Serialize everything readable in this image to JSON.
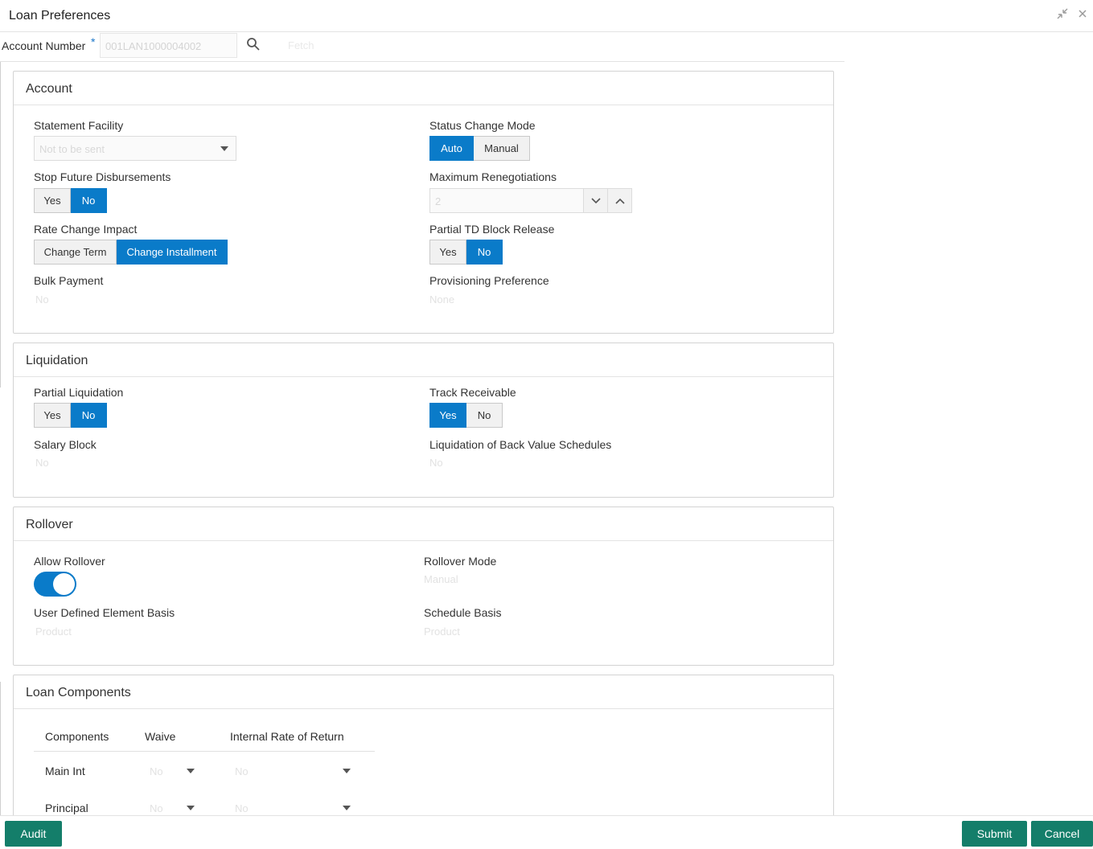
{
  "window": {
    "title": "Loan Preferences"
  },
  "account_bar": {
    "label": "Account Number",
    "required_mark": "*",
    "account_value": "001LAN1000004002",
    "ghost_text": "Fetch"
  },
  "account_section": {
    "title": "Account",
    "statement_facility": {
      "label": "Statement Facility",
      "value": "Not to be sent"
    },
    "status_change_mode": {
      "label": "Status Change Mode",
      "options": [
        "Auto",
        "Manual"
      ],
      "selected": "Auto"
    },
    "stop_future_disbursements": {
      "label": "Stop Future Disbursements",
      "options": [
        "Yes",
        "No"
      ],
      "selected": "No"
    },
    "maximum_renegotiations": {
      "label": "Maximum Renegotiations",
      "value": "2"
    },
    "rate_change_impact": {
      "label": "Rate Change Impact",
      "options": [
        "Change Term",
        "Change Installment"
      ],
      "selected": "Change Installment"
    },
    "partial_td_block_release": {
      "label": "Partial TD Block Release",
      "options": [
        "Yes",
        "No"
      ],
      "selected": "No"
    },
    "bulk_payment": {
      "label": "Bulk Payment",
      "value": "No"
    },
    "provisioning_preference": {
      "label": "Provisioning Preference",
      "value": "None"
    }
  },
  "liquidation_section": {
    "title": "Liquidation",
    "partial_liquidation": {
      "label": "Partial Liquidation",
      "options": [
        "Yes",
        "No"
      ],
      "selected": "No"
    },
    "track_receivable": {
      "label": "Track Receivable",
      "options": [
        "Yes",
        "No"
      ],
      "selected": "Yes"
    },
    "salary_block": {
      "label": "Salary Block",
      "value": "No"
    },
    "liquidation_back_value": {
      "label": "Liquidation of Back Value Schedules",
      "value": "No"
    }
  },
  "rollover_section": {
    "title": "Rollover",
    "allow_rollover": {
      "label": "Allow Rollover",
      "on": true
    },
    "rollover_mode": {
      "label": "Rollover Mode",
      "value": "Manual"
    },
    "user_defined_element_basis": {
      "label": "User Defined Element Basis",
      "value": "Product"
    },
    "schedule_basis": {
      "label": "Schedule Basis",
      "value": "Product"
    }
  },
  "loan_components_section": {
    "title": "Loan Components",
    "columns": [
      "Components",
      "Waive",
      "Internal Rate of Return"
    ],
    "rows": [
      {
        "component": "Main Int",
        "waive": "No",
        "irr": "No"
      },
      {
        "component": "Principal",
        "waive": "No",
        "irr": "No"
      }
    ]
  },
  "footer": {
    "audit_label": "Audit",
    "submit_label": "Submit",
    "cancel_label": "Cancel"
  },
  "colors": {
    "accent_blue": "#0a7bc9",
    "action_green": "#147e6a"
  }
}
